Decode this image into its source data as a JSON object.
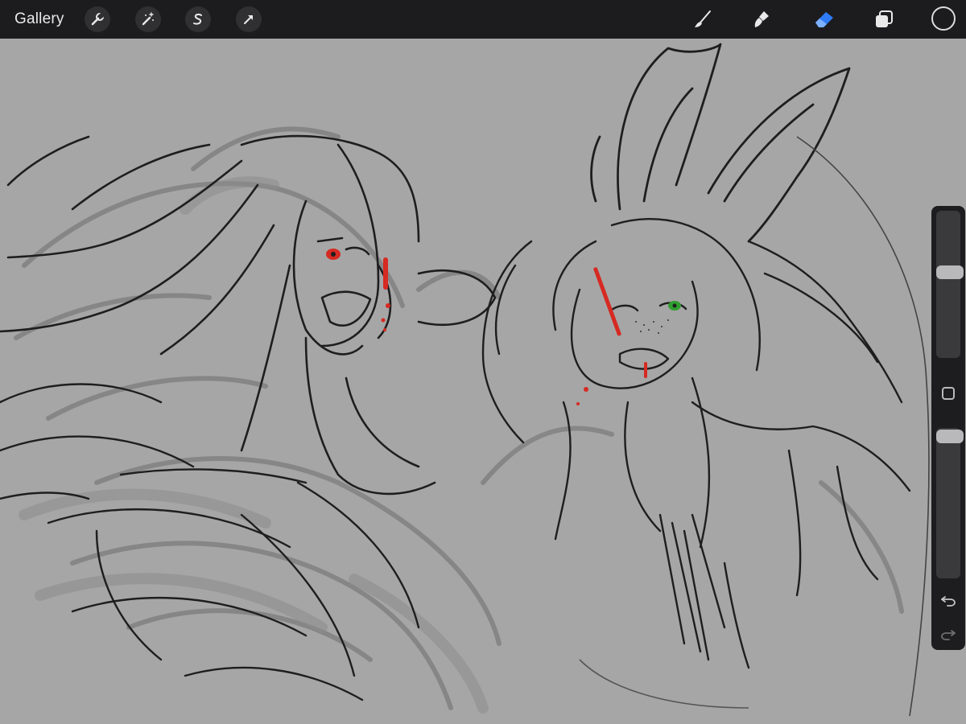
{
  "toolbar": {
    "gallery_label": "Gallery",
    "left_tools": [
      {
        "name": "actions",
        "icon": "wrench-icon"
      },
      {
        "name": "adjustments",
        "icon": "magic-wand-icon"
      },
      {
        "name": "selection",
        "icon": "selection-s-icon"
      },
      {
        "name": "transform",
        "icon": "arrow-cursor-icon"
      }
    ],
    "right_tools": [
      {
        "name": "brush",
        "icon": "brush-icon",
        "active": false
      },
      {
        "name": "smudge",
        "icon": "smudge-icon",
        "active": false
      },
      {
        "name": "eraser",
        "icon": "eraser-icon",
        "active": true
      },
      {
        "name": "layers",
        "icon": "layers-icon",
        "active": false
      }
    ],
    "current_color": "#1c1c1e",
    "active_tool_color": "#2f7bf6"
  },
  "sidebar": {
    "brush_size_level": 0.62,
    "opacity_level": 0.98,
    "buttons": [
      "undo-icon",
      "redo-icon"
    ]
  },
  "canvas": {
    "background_color": "#a6a6a6",
    "accent_colors": [
      "#d62a22",
      "#2f9e2f"
    ]
  }
}
